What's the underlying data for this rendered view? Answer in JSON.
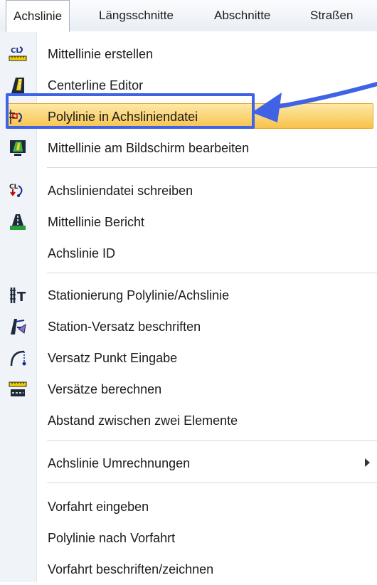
{
  "menubar": {
    "items": [
      "Achslinie",
      "Längsschnitte",
      "Abschnitte",
      "Straßen"
    ]
  },
  "menu": {
    "items": [
      {
        "label": "Mittellinie erstellen",
        "icon": "create-centerline-icon"
      },
      {
        "label": "Centerline Editor",
        "icon": "centerline-editor-icon"
      },
      {
        "label": "Polylinie in Achsliniendatei",
        "icon": "polyline-to-centerline-icon",
        "highlighted": true
      },
      {
        "label": "Mittellinie am Bildschirm bearbeiten",
        "icon": "edit-centerline-onscreen-icon"
      },
      {
        "label": "Achsliniendatei schreiben",
        "icon": "write-centerline-file-icon"
      },
      {
        "label": "Mittellinie Bericht",
        "icon": "centerline-report-icon"
      },
      {
        "label": "Achslinie ID",
        "icon": ""
      },
      {
        "label": "Stationierung Polylinie/Achslinie",
        "icon": "station-polyline-icon"
      },
      {
        "label": "Station-Versatz beschriften",
        "icon": "label-station-offset-icon"
      },
      {
        "label": "Versatz Punkt Eingabe",
        "icon": "offset-point-entry-icon"
      },
      {
        "label": "Versätze berechnen",
        "icon": "calculate-offsets-icon"
      },
      {
        "label": "Abstand zwischen zwei Elemente",
        "icon": ""
      },
      {
        "label": "Achslinie Umrechnungen",
        "icon": "",
        "submenu": true
      },
      {
        "label": "Vorfahrt eingeben",
        "icon": ""
      },
      {
        "label": "Polylinie nach Vorfahrt",
        "icon": ""
      },
      {
        "label": "Vorfahrt beschriften/zeichnen",
        "icon": ""
      }
    ]
  },
  "colors": {
    "highlight": "#f7c24a",
    "annotation": "#3f62e6"
  }
}
